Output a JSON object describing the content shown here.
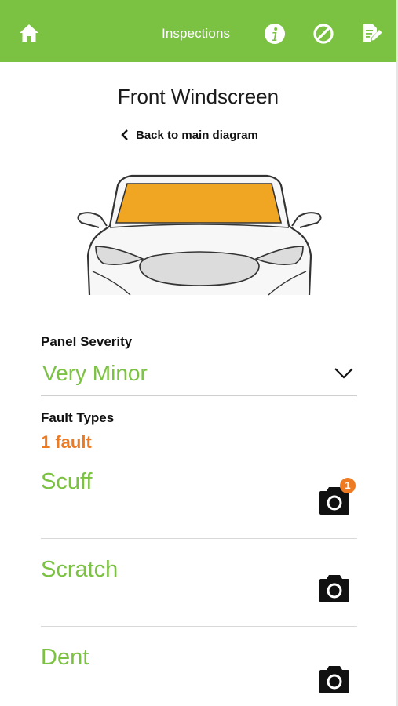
{
  "header": {
    "title": "Inspections",
    "icons": [
      "home-icon",
      "info-icon",
      "block-icon",
      "edit-document-icon"
    ],
    "background": "#7bc142"
  },
  "page": {
    "title": "Front Windscreen",
    "back_label": "Back to main diagram"
  },
  "diagram": {
    "highlighted_panel": "windscreen",
    "highlight_color": "#f0a623"
  },
  "severity": {
    "label": "Panel Severity",
    "value": "Very Minor"
  },
  "faults": {
    "label": "Fault Types",
    "count_text": "1 fault",
    "items": [
      {
        "name": "Scuff",
        "photo_count": "1"
      },
      {
        "name": "Scratch"
      },
      {
        "name": "Dent"
      }
    ]
  },
  "colors": {
    "accent": "#7bc142",
    "warning": "#ee7b22"
  }
}
